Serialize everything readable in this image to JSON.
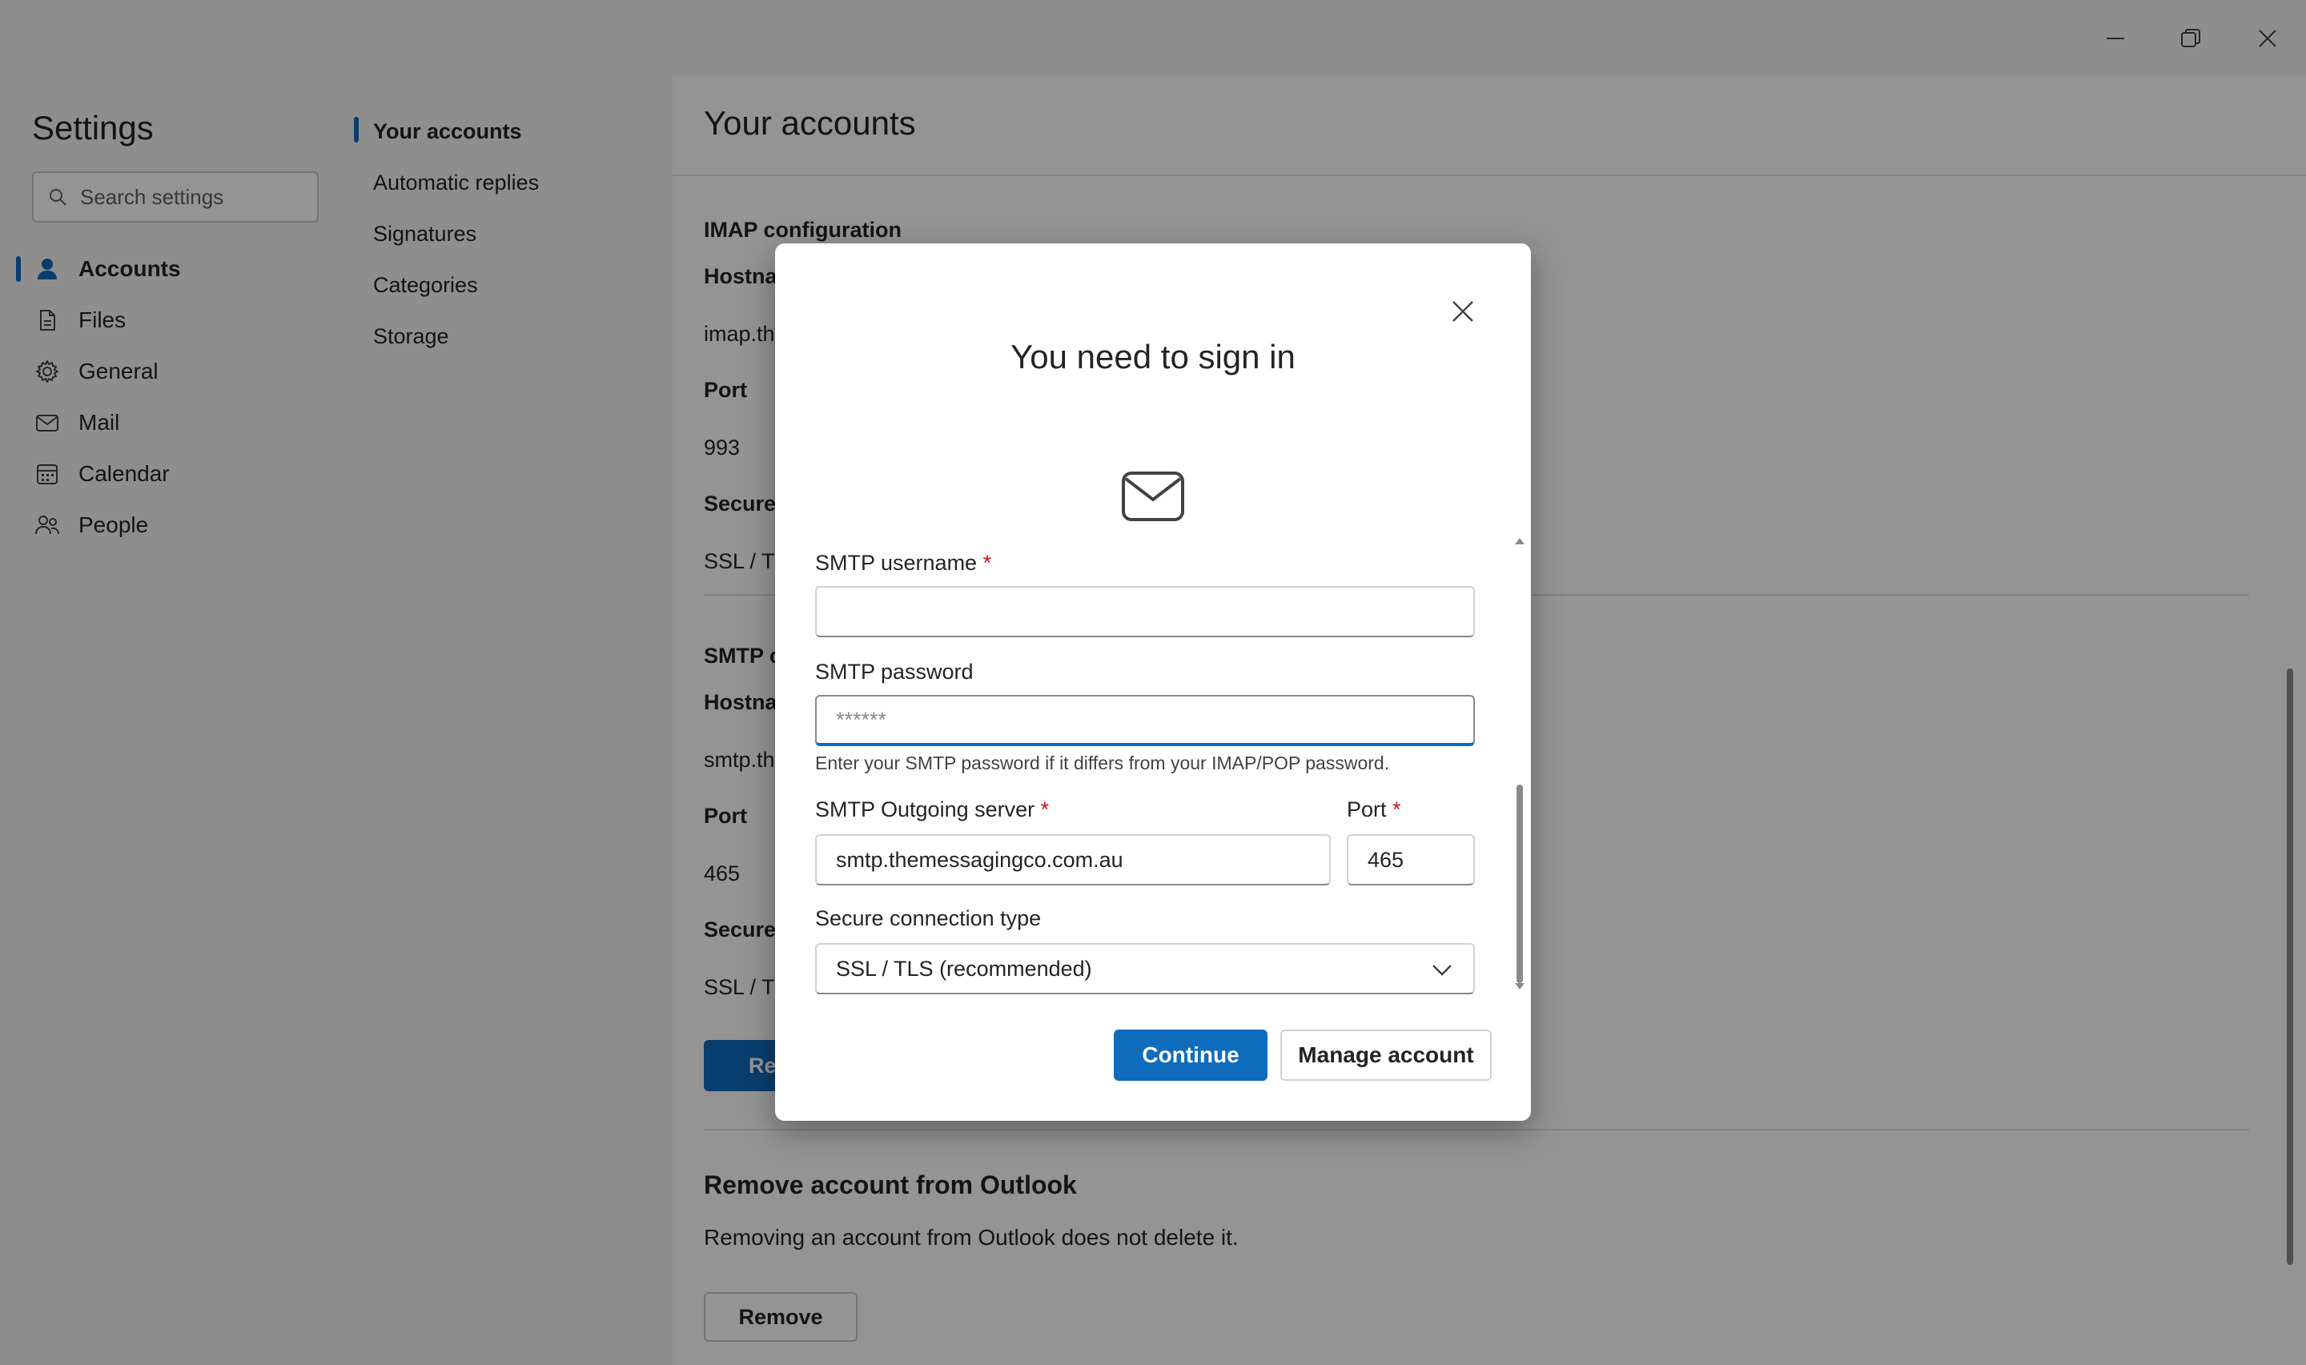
{
  "window": {
    "minimize_icon": "minimize-icon",
    "restore_icon": "restore-icon",
    "close_icon": "close-icon"
  },
  "settings": {
    "title": "Settings",
    "search_placeholder": "Search settings"
  },
  "nav": {
    "items": [
      {
        "label": "Accounts",
        "icon": "person-icon",
        "active": true
      },
      {
        "label": "Files",
        "icon": "file-icon"
      },
      {
        "label": "General",
        "icon": "gear-icon"
      },
      {
        "label": "Mail",
        "icon": "mail-icon"
      },
      {
        "label": "Calendar",
        "icon": "calendar-icon"
      },
      {
        "label": "People",
        "icon": "people-icon"
      }
    ]
  },
  "subnav": {
    "items": [
      {
        "label": "Your accounts",
        "active": true
      },
      {
        "label": "Automatic replies"
      },
      {
        "label": "Signatures"
      },
      {
        "label": "Categories"
      },
      {
        "label": "Storage"
      }
    ]
  },
  "content": {
    "title": "Your accounts",
    "imap_heading": "IMAP configuration",
    "imap_hostname_label": "Hostna",
    "imap_hostname_value": "imap.th",
    "imap_port_label": "Port",
    "imap_port_value": "993",
    "imap_secure_label": "Secure",
    "imap_secure_value": "SSL / TL",
    "smtp_heading": "SMTP c",
    "smtp_hostname_label": "Hostna",
    "smtp_hostname_value": "smtp.th",
    "smtp_port_label": "Port",
    "smtp_port_value": "465",
    "smtp_secure_label": "Secure",
    "smtp_secure_value": "SSL / TL",
    "partial_button": "Re",
    "remove_heading": "Remove account from Outlook",
    "remove_desc": "Removing an account from Outlook does not delete it.",
    "remove_button": "Remove"
  },
  "dialog": {
    "title": "You need to sign in",
    "icon": "mail-icon",
    "smtp_username_label": "SMTP username",
    "smtp_username_value": "",
    "smtp_password_label": "SMTP password",
    "smtp_password_placeholder": "******",
    "smtp_password_hint": "Enter your SMTP password if it differs from your IMAP/POP password.",
    "smtp_server_label": "SMTP Outgoing server",
    "smtp_server_value": "smtp.themessagingco.com.au",
    "port_label": "Port",
    "port_value": "465",
    "secure_label": "Secure connection type",
    "secure_value": "SSL / TLS (recommended)",
    "required_marker": "*",
    "continue_button": "Continue",
    "manage_button": "Manage account"
  },
  "colors": {
    "accent": "#0f6cbd",
    "required": "#c50f1f"
  }
}
